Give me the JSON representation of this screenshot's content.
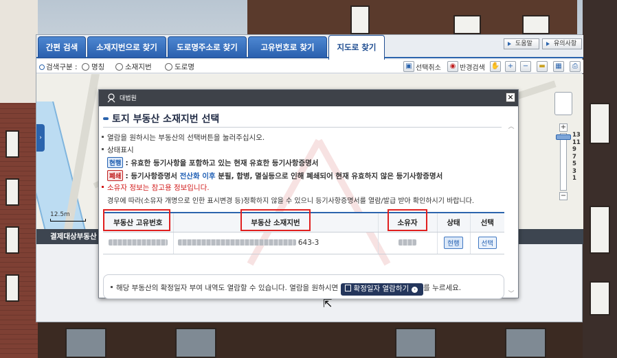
{
  "tabs": [
    {
      "label": "간편 검색"
    },
    {
      "label": "소재지번으로 찾기"
    },
    {
      "label": "도로명주소로 찾기"
    },
    {
      "label": "고유번호로 찾기"
    },
    {
      "label": "지도로 찾기",
      "active": true
    }
  ],
  "top_buttons": {
    "help": "도움말",
    "notes": "유의사항"
  },
  "toolbar": {
    "search_type_label": "검색구분 :",
    "options": [
      "명칭",
      "소재지번",
      "도로명"
    ],
    "deselect": "선택취소",
    "reflect_search": "반경검색"
  },
  "map": {
    "scale": "12.5m",
    "status_strip": "결제대상부동산"
  },
  "zoom_levels": [
    "13",
    "11",
    "9",
    "7",
    "5",
    "3",
    "1"
  ],
  "modal": {
    "court": "대법원",
    "close": "×",
    "title": "토지 부동산 소재지번 선택",
    "lines": {
      "instruction": "열람을 원하시는 부동산의 선택버튼을 눌러주십시오.",
      "status_header": "상태표시",
      "current_badge": "현행",
      "current_desc": ": 유효한 등기사항을 포함하고 있는 현재 유효한 등기사항증명서",
      "closed_badge": "폐쇄",
      "closed_desc_a": ": 등기사항증명서 ",
      "closed_desc_b": "전산화 이후",
      "closed_desc_c": " 분필, 합병, 멸실등으로 인해 폐쇄되어 현재 유효하지 않은 등기사항증명서",
      "owner_note": "소유자 정보는 참고용 정보입니다.",
      "change_note": "경우에 따라(소유자 개명으로 인한 표시변경 등)정확하지 않을 수 있으니 등기사항증명서를 열람/발급 받아 확인하시기 바랍니다."
    },
    "table": {
      "headers": [
        "부동산 고유번호",
        "부동산 소재지번",
        "소유자",
        "상태",
        "선택"
      ],
      "rows": [
        {
          "address_tail": "643-3",
          "status": "현행",
          "select": "선택"
        }
      ]
    },
    "notice": {
      "text_before": "해당 부동산의 확정일자 부여 내역도 열람할 수 있습니다. 열람을 원하시면",
      "button": "확정일자 열람하기",
      "text_after": "를 누르세요."
    }
  },
  "colors": {
    "accent": "#2b64ad",
    "highlight_box": "#e01e1e",
    "header_bar": "#3e4249"
  }
}
